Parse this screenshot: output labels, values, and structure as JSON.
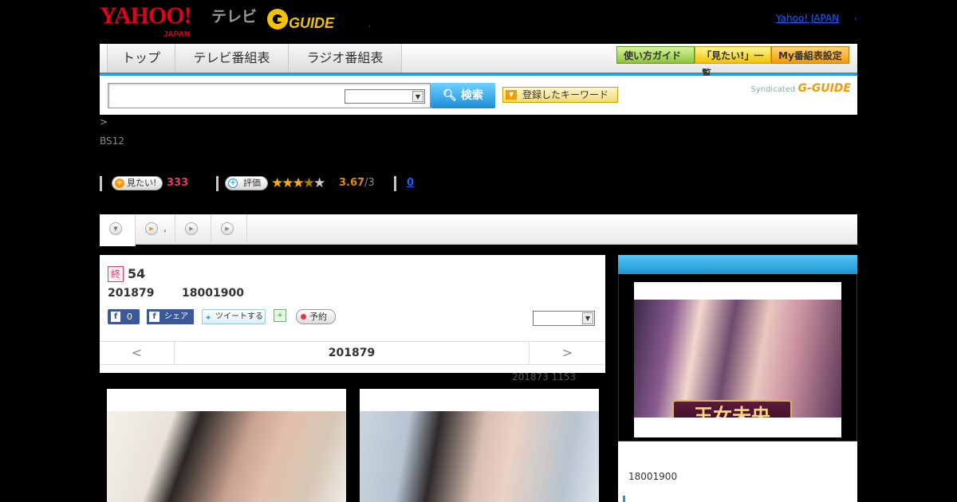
{
  "header": {
    "yahoo_logo": "YAHOO!",
    "yahoo_japan_sub": "JAPAN",
    "tv_label": "テレビ",
    "gguide_logo": "G-GUIDE",
    "tiny_dot": ",",
    "yahoo_japan_link": "Yahoo! JAPAN",
    "link_separator": ","
  },
  "nav": {
    "tabs": [
      {
        "label": "トップ"
      },
      {
        "label": "テレビ番組表"
      },
      {
        "label": "ラジオ番組表"
      }
    ],
    "guide_button": "使い方ガイド",
    "mitai_list_button": "「見たい!」一覧",
    "my_schedule_button": "My番組表設定"
  },
  "search": {
    "input_value": "",
    "select_value": "",
    "search_button": "検索",
    "keyword_button": "登録したキーワード",
    "syndicated_label": "Syndicated",
    "syndicated_logo": "G-GUIDE"
  },
  "program": {
    "breadcrumb_sep": ">",
    "channel": "BS12",
    "mitai_button": "見たい!",
    "mitai_count": "333",
    "rate_button": "評価",
    "rating_value": "3.67",
    "rating_count_suffix": "/3",
    "review_count": "0",
    "stars_filled": 3.67,
    "stars_total": 5
  },
  "subtabs": [
    {
      "icon": "dropdown-arrow-icon",
      "label": ""
    },
    {
      "icon": "play-icon",
      "label": ","
    },
    {
      "icon": "play-icon",
      "label": ""
    },
    {
      "icon": "play-icon",
      "label": ""
    }
  ],
  "episode": {
    "end_badge": "終",
    "episode_number": "54",
    "air_date": "201879",
    "air_time": "18001900",
    "fb_like_count": "0",
    "fb_share_label": "シェア",
    "tweet_label": "ツイートする",
    "reserve_label": "予約",
    "select_value": "",
    "prev_day": "<",
    "current_day": "201879",
    "next_day": ">",
    "updated_text": "201873  1153"
  },
  "sidebar": {
    "poster_title": "王女未央",
    "time_text": "18001900"
  },
  "colors": {
    "nav_accent": "#1ea0dc",
    "search_button": "#1a8fd6",
    "mitai_count": "#e0396a",
    "rating": "#e08a00",
    "star_on": "#f3b000",
    "yahoo_red": "#e0001b"
  }
}
